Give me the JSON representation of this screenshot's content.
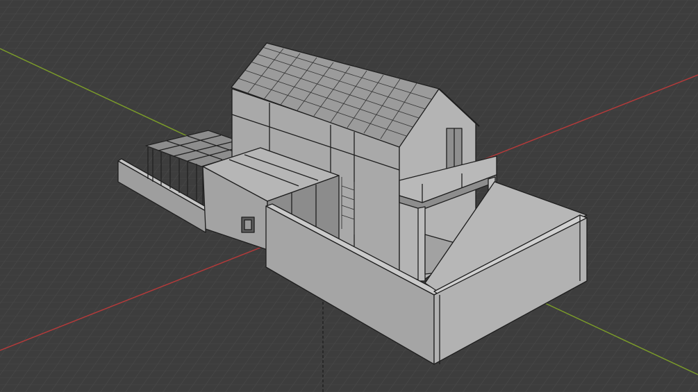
{
  "viewport": {
    "background": "#3d3d3d",
    "grid_color": "#4a4a4a",
    "x_axis_color": "#b23a3a",
    "y_axis_color": "#7a9a2a",
    "z_axis_color": "#222222",
    "model_color": "#a7a7a7",
    "edge_color": "#1e1e1e"
  }
}
